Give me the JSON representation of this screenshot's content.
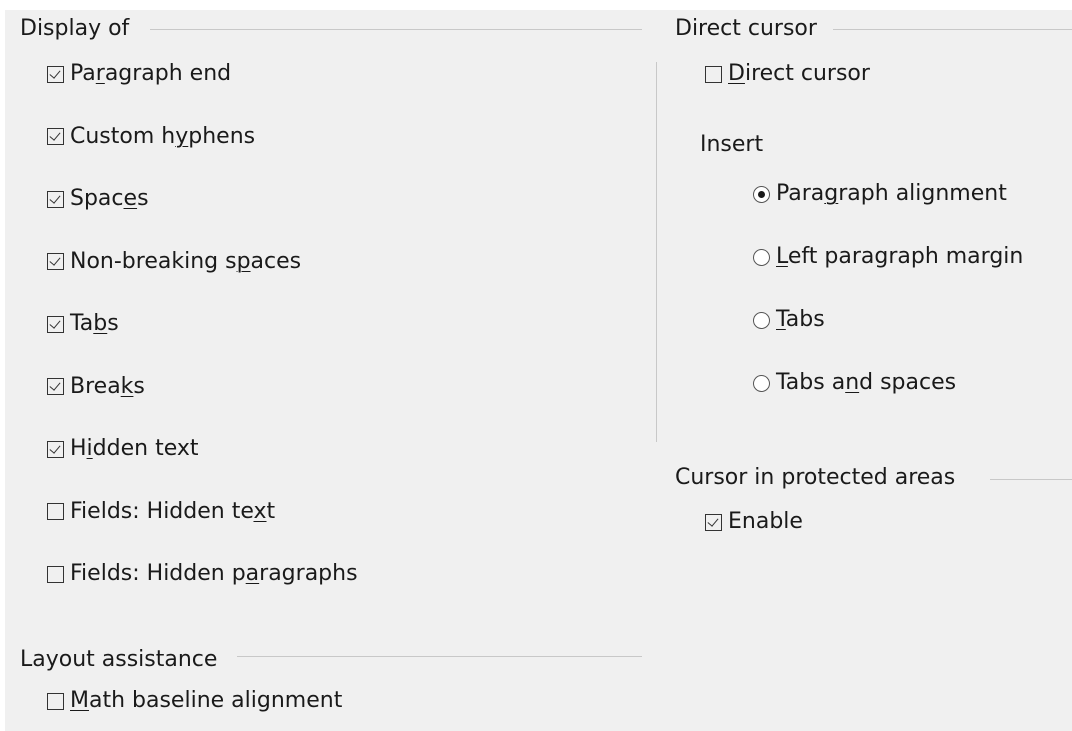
{
  "display_of": {
    "title": "Display of",
    "options": [
      {
        "pre": "Pa",
        "key": "r",
        "post": "agraph end",
        "checked": true
      },
      {
        "pre": "Custom h",
        "key": "y",
        "post": "phens",
        "checked": true
      },
      {
        "pre": "Spac",
        "key": "e",
        "post": "s",
        "checked": true
      },
      {
        "pre": "Non-breaking s",
        "key": "p",
        "post": "aces",
        "checked": true
      },
      {
        "pre": "Ta",
        "key": "b",
        "post": "s",
        "checked": true
      },
      {
        "pre": "Brea",
        "key": "k",
        "post": "s",
        "checked": true
      },
      {
        "pre": "H",
        "key": "i",
        "post": "dden text",
        "checked": true
      },
      {
        "pre": "Fields: Hidden te",
        "key": "x",
        "post": "t",
        "checked": false
      },
      {
        "pre": "Fields: Hidden p",
        "key": "a",
        "post": "ragraphs",
        "checked": false
      }
    ]
  },
  "layout_assistance": {
    "title": "Layout assistance",
    "options": [
      {
        "pre": "",
        "key": "M",
        "post": "ath baseline alignment",
        "checked": false
      }
    ]
  },
  "direct_cursor": {
    "title": "Direct cursor",
    "checkbox": {
      "pre": "",
      "key": "D",
      "post": "irect cursor",
      "checked": false
    },
    "insert_label": "Insert",
    "insert_options": [
      {
        "pre": "Para",
        "key": "g",
        "post": "raph alignment",
        "selected": true
      },
      {
        "pre": "",
        "key": "L",
        "post": "eft paragraph margin",
        "selected": false
      },
      {
        "pre": "",
        "key": "T",
        "post": "abs",
        "selected": false
      },
      {
        "pre": "Tabs a",
        "key": "n",
        "post": "d spaces",
        "selected": false
      }
    ]
  },
  "cursor_protected": {
    "title": "Cursor in protected areas",
    "checkbox": {
      "pre": "",
      "key": "",
      "post": "Enable",
      "checked": true
    }
  }
}
